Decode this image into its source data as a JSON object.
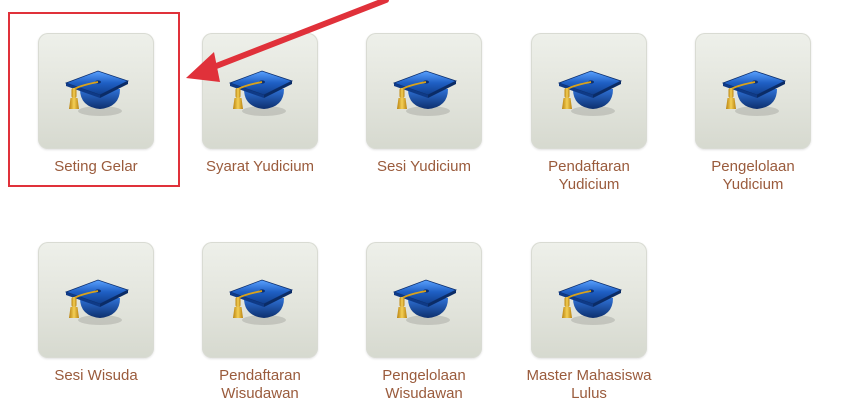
{
  "menu": {
    "items": [
      {
        "label": "Seting Gelar",
        "icon": "graduation-cap-icon"
      },
      {
        "label": "Syarat Yudicium",
        "icon": "graduation-cap-icon"
      },
      {
        "label": "Sesi Yudicium",
        "icon": "graduation-cap-icon"
      },
      {
        "label": "Pendaftaran\nYudicium",
        "icon": "graduation-cap-icon"
      },
      {
        "label": "Pengelolaan\nYudicium",
        "icon": "graduation-cap-icon"
      },
      {
        "label": "Sesi Wisuda",
        "icon": "graduation-cap-icon"
      },
      {
        "label": "Pendaftaran\nWisudawan",
        "icon": "graduation-cap-icon"
      },
      {
        "label": "Pengelolaan\nWisudawan",
        "icon": "graduation-cap-icon"
      },
      {
        "label": "Master Mahasiswa\nLulus",
        "icon": "graduation-cap-icon"
      }
    ]
  },
  "annotation": {
    "highlight_color": "#e0313a",
    "highlighted_item": "Seting Gelar"
  },
  "colors": {
    "label_text": "#9a5b3c",
    "cap_blue": "#1f5fc4",
    "tassel_gold": "#d8a21c"
  }
}
